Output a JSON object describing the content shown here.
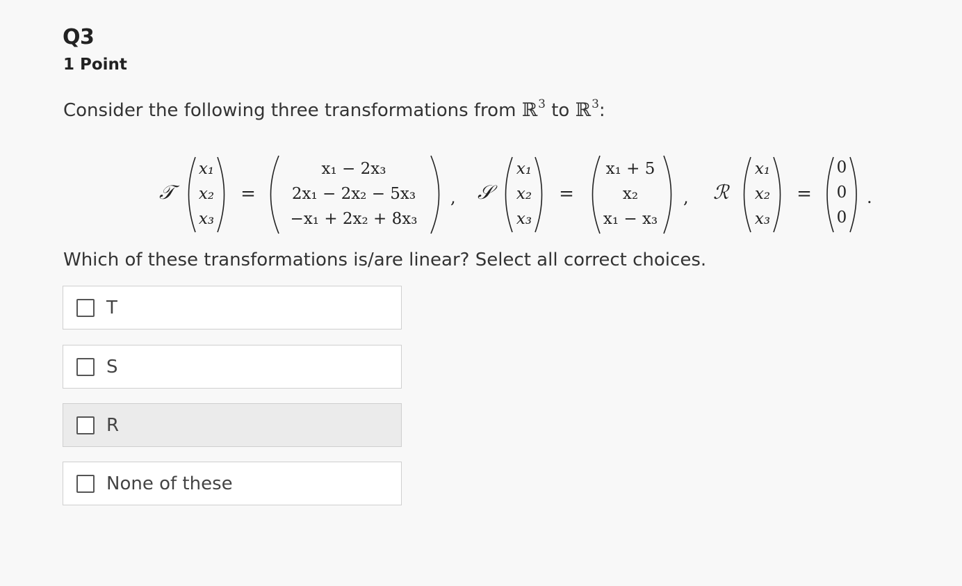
{
  "question": {
    "number": "Q3",
    "points": "1 Point",
    "prompt_before": "Consider the following three transformations from ",
    "field_symbol": "ℝ",
    "exponent": "3",
    "prompt_middle": " to ",
    "prompt_after": ":",
    "question_text": "Which of these transformations is/are linear? Select all correct choices."
  },
  "math": {
    "transformations": [
      {
        "name": "𝒯",
        "input": [
          "x₁",
          "x₂",
          "x₃"
        ],
        "output": [
          "x₁ − 2x₃",
          "2x₁ − 2x₂ − 5x₃",
          "−x₁ + 2x₂ + 8x₃"
        ],
        "separator": ","
      },
      {
        "name": "𝒮",
        "input": [
          "x₁",
          "x₂",
          "x₃"
        ],
        "output": [
          "x₁ + 5",
          "x₂",
          "x₁ − x₃"
        ],
        "separator": ","
      },
      {
        "name": "ℛ",
        "input": [
          "x₁",
          "x₂",
          "x₃"
        ],
        "output": [
          "0",
          "0",
          "0"
        ],
        "separator": "."
      }
    ],
    "equals": "="
  },
  "choices": [
    {
      "label": "T",
      "checked": false
    },
    {
      "label": "S",
      "checked": false
    },
    {
      "label": "R",
      "checked": false,
      "hovered": true
    },
    {
      "label": "None of these",
      "checked": false
    }
  ]
}
